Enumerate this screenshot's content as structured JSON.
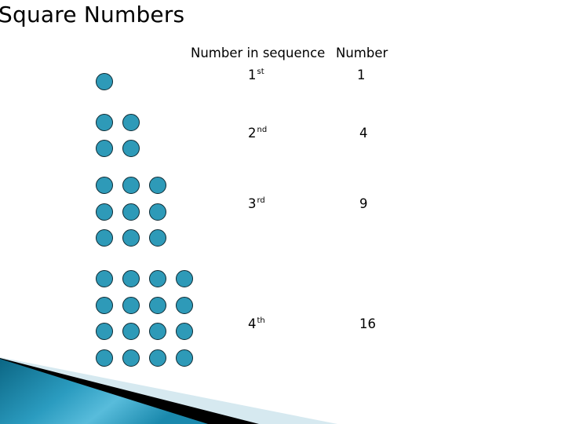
{
  "slide": {
    "title": "Square Numbers",
    "table": {
      "headers": [
        "Number in sequence",
        "Number"
      ],
      "rows": [
        {
          "ordinal": "1",
          "suffix": "st",
          "value": "1",
          "dots_per_side": 1
        },
        {
          "ordinal": "2",
          "suffix": "nd",
          "value": "4",
          "dots_per_side": 2
        },
        {
          "ordinal": "3",
          "suffix": "rd",
          "value": "9",
          "dots_per_side": 3
        },
        {
          "ordinal": "4",
          "suffix": "th",
          "value": "16",
          "dots_per_side": 4
        }
      ]
    },
    "colors": {
      "dot_fill": "#2e9ab8",
      "dot_stroke": "#0e2a33",
      "accent_dark": "#0a6a8a",
      "accent_light": "#5bbfdc",
      "band_light": "#d6e9f0"
    }
  }
}
